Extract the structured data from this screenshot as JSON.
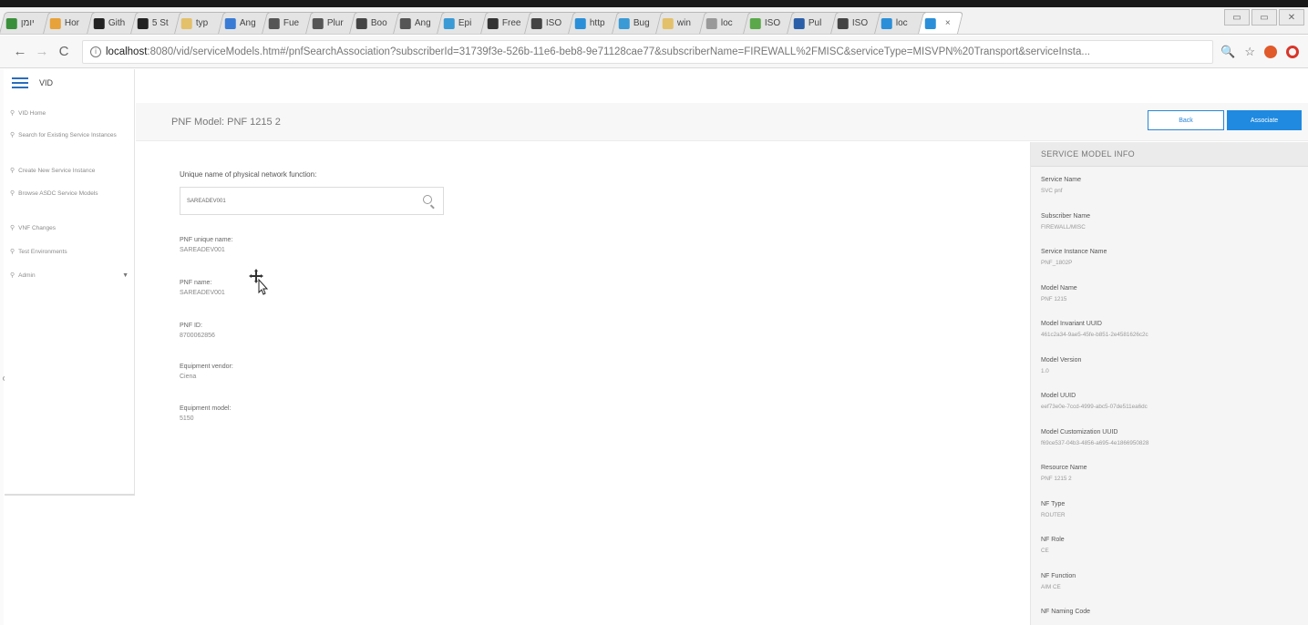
{
  "browser": {
    "tabs": [
      {
        "label": "יומן",
        "color": "#3a8f3a"
      },
      {
        "label": "Hor",
        "color": "#e8a23a"
      },
      {
        "label": "Gith",
        "color": "#222222"
      },
      {
        "label": "5 St",
        "color": "#222222"
      },
      {
        "label": "typ",
        "color": "#e3c06a"
      },
      {
        "label": "Ang",
        "color": "#3a7bd5"
      },
      {
        "label": "Fue",
        "color": "#555555"
      },
      {
        "label": "Plur",
        "color": "#555555"
      },
      {
        "label": "Boo",
        "color": "#444444"
      },
      {
        "label": "Ang",
        "color": "#555555"
      },
      {
        "label": "Epi",
        "color": "#3a9ad5"
      },
      {
        "label": "Free",
        "color": "#333333"
      },
      {
        "label": "ISO",
        "color": "#444444"
      },
      {
        "label": "http",
        "color": "#2a8fd8"
      },
      {
        "label": "Bug",
        "color": "#3a9ad5"
      },
      {
        "label": "win",
        "color": "#e3c06a"
      },
      {
        "label": "loc",
        "color": "#999999"
      },
      {
        "label": "ISO",
        "color": "#5aa84a"
      },
      {
        "label": "Pul",
        "color": "#2a5ea8"
      },
      {
        "label": "ISO",
        "color": "#444444"
      },
      {
        "label": "loc",
        "color": "#2a8fd8"
      }
    ],
    "active_tab": {
      "close": "×",
      "color": "#2a8fd8"
    },
    "url_host": "localhost",
    "url_rest": ":8080/vid/serviceModels.htm#/pnfSearchAssociation?subscriberId=31739f3e-526b-11e6-beb8-9e71128cae77&subscriberName=FIREWALL%2FMISC&serviceType=MISVPN%20Transport&serviceInsta...",
    "nav": {
      "back": "←",
      "forward": "→",
      "reload": "C",
      "info": "i"
    },
    "toolbar": {
      "zoom": "🔍",
      "star": "☆"
    },
    "window_controls": [
      "▭",
      "▭",
      "✕"
    ]
  },
  "sidebar": {
    "brand": "VID",
    "items": [
      {
        "label": "VID Home",
        "caret": ""
      },
      {
        "label": "Search for Existing Service Instances",
        "caret": ""
      },
      {
        "label": "Create New Service Instance",
        "caret": ""
      },
      {
        "label": "Browse ASDC Service Models",
        "caret": ""
      },
      {
        "label": "VNF Changes",
        "caret": ""
      },
      {
        "label": "Test Environments",
        "caret": ""
      },
      {
        "label": "Admin",
        "caret": "▼"
      }
    ],
    "pin_glyph": "⚲"
  },
  "header": {
    "title": "PNF Model: PNF 1215 2",
    "back_label": "Back",
    "associate_label": "Associate"
  },
  "form": {
    "search_label": "Unique name of physical network function:",
    "search_value": "SAREADEV001",
    "fields": [
      {
        "key": "PNF unique name:",
        "value": "SAREADEV001"
      },
      {
        "key": "PNF name:",
        "value": "SAREADEV001"
      },
      {
        "key": "PNF ID:",
        "value": "8700062856"
      },
      {
        "key": "Equipment vendor:",
        "value": "Ciena"
      },
      {
        "key": "Equipment model:",
        "value": "5150"
      }
    ]
  },
  "info": {
    "title": "SERVICE MODEL INFO",
    "rows": [
      {
        "key": "Service Name",
        "value": "SVC pnf"
      },
      {
        "key": "Subscriber Name",
        "value": "FIREWALL/MISC"
      },
      {
        "key": "Service Instance Name",
        "value": "PNF_1802P"
      },
      {
        "key": "Model Name",
        "value": "PNF 1215"
      },
      {
        "key": "Model Invariant UUID",
        "value": "461c2a34-9ae5-45fe-b851-2e4581626c2c"
      },
      {
        "key": "Model Version",
        "value": "1.0"
      },
      {
        "key": "Model UUID",
        "value": "eef73e0e-7ccd-4999-abc5-07de511ea6dc"
      },
      {
        "key": "Model Customization UUID",
        "value": "f69ce537-04b3-4856-a695-4e1866950828"
      },
      {
        "key": "Resource Name",
        "value": "PNF 1215 2"
      },
      {
        "key": "NF Type",
        "value": "ROUTER"
      },
      {
        "key": "NF Role",
        "value": "CE"
      },
      {
        "key": "NF Function",
        "value": "AIM CE"
      },
      {
        "key": "NF Naming Code",
        "value": ""
      }
    ]
  }
}
